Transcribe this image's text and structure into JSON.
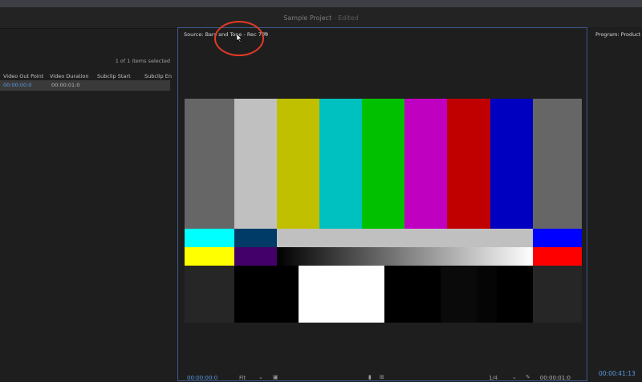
{
  "window": {
    "project_name": "Sample Project",
    "edited_suffix": " - Edited"
  },
  "project_panel": {
    "selection_status": "1 of 1 items selected",
    "columns": [
      "Video Out Point",
      "Video Duration",
      "Subclip Start",
      "Subclip En"
    ],
    "row": {
      "video_out_point": "00:00:00:0",
      "video_duration": "00:00:01:0"
    }
  },
  "source_monitor": {
    "tab_label": "Source: Bars and Tone - Rec 709",
    "menu_glyph": "≡",
    "timecode": "00:00:00:0",
    "fit_label": "Fit",
    "zoom_label": "1/4",
    "duration_timecode": "00:00:01:0",
    "color_bars": {
      "top_row": [
        "#666666",
        "#c0c0c0",
        "#c0c000",
        "#00c0c0",
        "#00c000",
        "#c000c0",
        "#c00000",
        "#0000c0",
        "#666666"
      ],
      "middle_row_1": [
        "#00ffff",
        "#003a66",
        "#c0c0c0",
        "#0000ff"
      ],
      "middle_row_2": [
        "#ffff00",
        "#43006b",
        "gradient",
        "#ff0000"
      ],
      "bottom_row": [
        "#262626",
        "#000000",
        "#ffffff",
        "#000000",
        "#0a0a0a",
        "#050505",
        "#000000",
        "#262626"
      ]
    }
  },
  "program_monitor": {
    "tab_label": "Program: Product W",
    "timecode": "00:00:41:13"
  },
  "annotation": {
    "color": "#e23b25"
  },
  "accent_colors": {
    "timecode_blue": "#5b9be0",
    "panel_focus_border": "#3c5a8c"
  }
}
